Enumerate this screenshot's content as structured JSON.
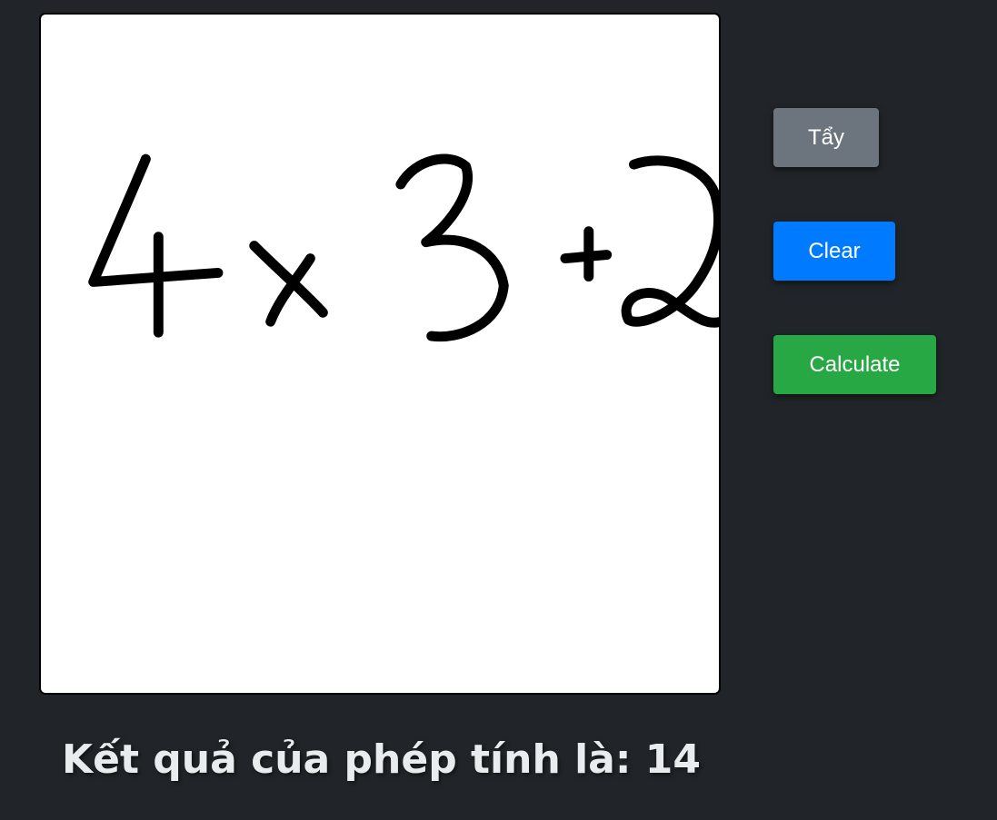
{
  "canvas": {
    "drawing": "4x3+2"
  },
  "buttons": {
    "erase_label": "Tẩy",
    "clear_label": "Clear",
    "calculate_label": "Calculate"
  },
  "result": {
    "text": "Kết quả của phép tính là: 14"
  },
  "colors": {
    "background": "#212529",
    "erase_button": "#6c757d",
    "clear_button": "#007bff",
    "calculate_button": "#28a745",
    "result_text": "#e9ecef"
  }
}
